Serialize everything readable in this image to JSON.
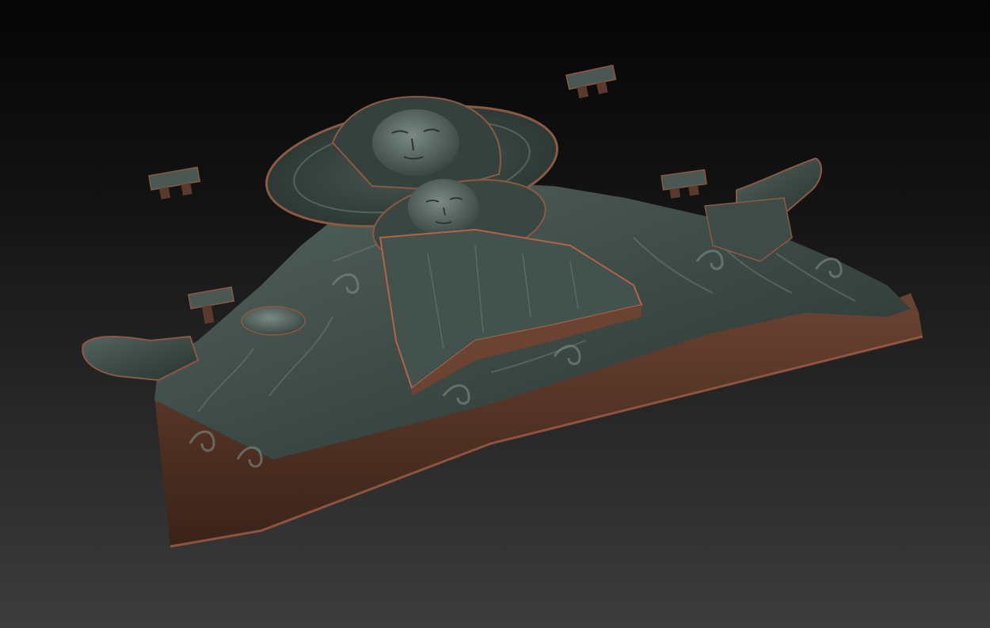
{
  "scene": {
    "subject": "icon-relief-sculpt",
    "background_gradient": [
      "#050505",
      "#121212",
      "#2a2a2a",
      "#3c3c3c"
    ],
    "material_colors": {
      "top_face": "#3d4a46",
      "top_face_highlight": "#6b7a73",
      "side_face": "#5a3a2c",
      "side_face_dark": "#3a2218",
      "rim_highlight": "#b0654a"
    }
  }
}
